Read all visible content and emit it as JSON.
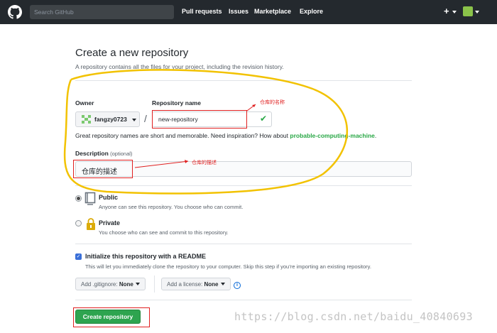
{
  "header": {
    "search_placeholder": "Search GitHub",
    "nav": [
      "Pull requests",
      "Issues",
      "Marketplace",
      "Explore"
    ],
    "plus_label": "+"
  },
  "page": {
    "title": "Create a new repository",
    "subtitle": "A repository contains all the files for your project, including the revision history."
  },
  "form": {
    "owner_label": "Owner",
    "owner_value": "fangzy0723",
    "slash": "/",
    "repo_label": "Repository name",
    "repo_value": "new-repository",
    "hint_text": "Great repository names are short and memorable. Need inspiration? How about ",
    "hint_suggestion": "probable-computing-machine",
    "hint_end": ".",
    "description_label": "Description",
    "description_optional": "(optional)",
    "description_value": "仓库的描述"
  },
  "visibility": {
    "public_title": "Public",
    "public_desc": "Anyone can see this repository. You choose who can commit.",
    "private_title": "Private",
    "private_desc": "You choose who can see and commit to this repository.",
    "selected": "public"
  },
  "init": {
    "checked": true,
    "title": "Initialize this repository with a README",
    "desc": "This will let you immediately clone the repository to your computer. Skip this step if you’re importing an existing repository."
  },
  "selects": {
    "gitignore_prefix": "Add .gitignore:",
    "gitignore_value": "None",
    "license_prefix": "Add a license:",
    "license_value": "None"
  },
  "create_button": "Create repository",
  "annotations": {
    "repo_note": "仓库的名称",
    "desc_note": "仓库的描述",
    "color": "#e02020",
    "highlight_color": "#f2c200"
  },
  "watermark": "https://blog.csdn.net/baidu_40840693",
  "colors": {
    "header_bg": "#24292e",
    "primary_green": "#2ea44f",
    "link_blue": "#0366d6"
  },
  "icons": [
    "github-logo-icon",
    "check-icon",
    "globe-book-icon",
    "lock-icon",
    "info-icon",
    "caret-down-icon"
  ]
}
